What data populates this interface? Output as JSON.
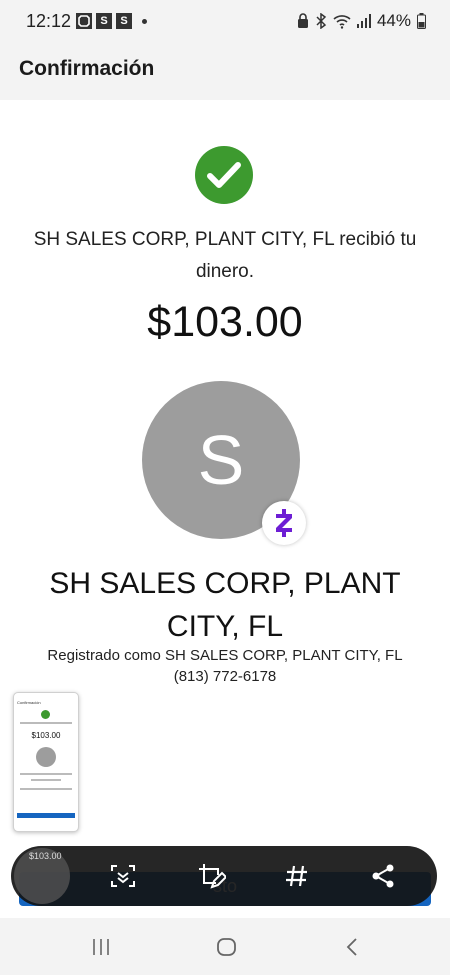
{
  "status_bar": {
    "time": "12:12",
    "left_icons": [
      "app-icon",
      "S",
      "S"
    ],
    "battery": "44%"
  },
  "app_bar": {
    "title": "Confirmación"
  },
  "confirmation": {
    "message": "SH SALES CORP, PLANT CITY, FL recibió tu dinero.",
    "amount": "$103.00"
  },
  "recipient": {
    "avatar_letter": "S",
    "name": "SH SALES CORP, PLANT CITY, FL",
    "registered_as": "Registrado como SH SALES CORP, PLANT CITY, FL",
    "phone": "(813) 772-6178"
  },
  "bottom_button": {
    "label_partial": "sto"
  },
  "toolbar": {
    "tools": [
      "scroll-capture-icon",
      "crop-edit-icon",
      "hashtag-icon",
      "share-icon"
    ]
  },
  "colors": {
    "success": "#3d9a2f",
    "primary": "#1565c0",
    "zelle": "#6d1ed4",
    "avatar": "#9d9d9d"
  }
}
